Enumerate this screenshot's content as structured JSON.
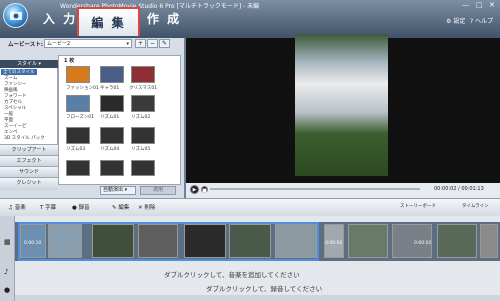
{
  "app": {
    "title": "Wondershare PhotoMovie Studio 6 Pro [マルチトラックモード] - 未編"
  },
  "nav": {
    "input": "入 力",
    "edit": "編 集",
    "create": "作 成"
  },
  "header_links": {
    "settings": "設定",
    "help": "ヘルプ"
  },
  "library": {
    "label": "ムービースト:",
    "selected": "ムービー2"
  },
  "styles": {
    "header": "スタイル",
    "items": [
      "全てのスタイル",
      "ズーム",
      "ファンシー",
      "映画風",
      "フォワード",
      "カプセル",
      "スペシャル",
      "一般",
      "平面",
      "スーイーピ",
      "エンペ",
      "3D スタイル パック"
    ],
    "grid_label": "1 枚",
    "thumbs": [
      "ファッション01",
      "ギャラ01",
      "クリスマス01",
      "フローズン01",
      "リズム01",
      "リズム02",
      "リズム03",
      "リズム04",
      "リズム05",
      "",
      "",
      ""
    ]
  },
  "categories": [
    "クリップアート",
    "エフェクト",
    "サウンド",
    "クレジット"
  ],
  "grid_footer": {
    "auto_apply": "自動演出",
    "apply": "適用"
  },
  "player": {
    "timecode": "00:00:02 / 00:01:13"
  },
  "toolbar": {
    "music": "音楽",
    "caption": "字幕",
    "record": "録音",
    "edit": "編集",
    "delete": "削除",
    "storyboard": "ストーリーボード",
    "timeline": "タイムライン"
  },
  "clips": [
    {
      "time": "0:00:10"
    },
    {
      "time": "0:00:02"
    },
    {
      "time": "0:00:02"
    }
  ],
  "hints": {
    "music": "ダブルクリックして、音楽を追加してください",
    "voice": "ダブルクリックして、録音してください"
  },
  "colors": {
    "accent": "#e0463f",
    "selection": "#4d8fe0"
  }
}
